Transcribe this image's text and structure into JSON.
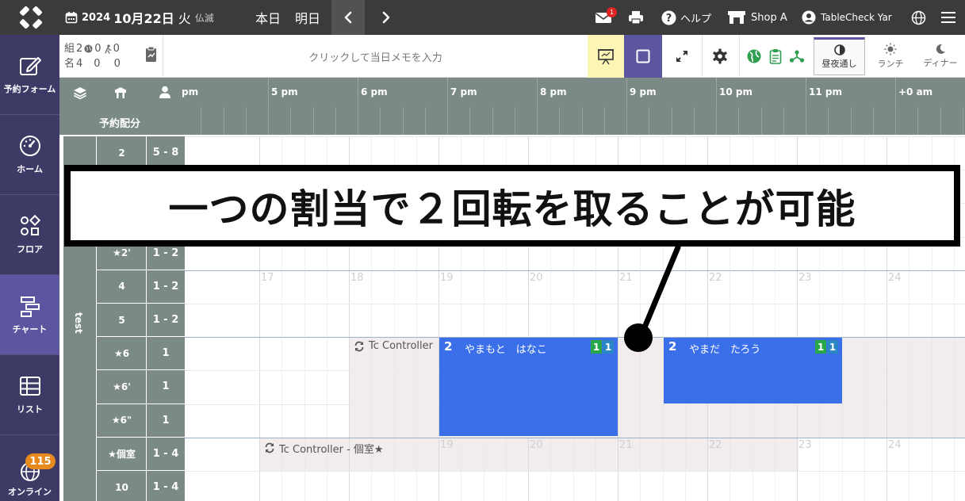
{
  "topbar": {
    "date_year": "2024",
    "date_monthday": "10月22日",
    "date_weekday": "火",
    "date_rokuyo": "仏滅",
    "today_label": "本日",
    "tomorrow_label": "明日",
    "mail_badge": "1",
    "help_label": "ヘルプ",
    "shop_label": "Shop A",
    "user_label": "TableCheck Yar"
  },
  "sidebar": {
    "items": [
      {
        "label": "予約フォーム",
        "icon": "edit-icon"
      },
      {
        "label": "ホーム",
        "icon": "dashboard-icon"
      },
      {
        "label": "フロア",
        "icon": "floor-icon"
      },
      {
        "label": "チャート",
        "icon": "chart-icon"
      },
      {
        "label": "リスト",
        "icon": "list-icon"
      },
      {
        "label": "オンライン",
        "icon": "globe-icon",
        "badge": "115"
      }
    ]
  },
  "toolbar": {
    "groups_label": "組",
    "groups_value": "2",
    "names_label": "名",
    "names_value": "4",
    "walkin_groups": "0",
    "web_groups": "0",
    "walkin_names": "0",
    "web_names": "0",
    "memo_placeholder": "クリックして当日メモを入力",
    "shift_all": "昼夜通し",
    "shift_lunch": "ランチ",
    "shift_dinner": "ディナー"
  },
  "grid": {
    "allocation_label": "予約配分",
    "section_label": "test",
    "hours": [
      "pm",
      "5 pm",
      "6 pm",
      "7 pm",
      "8 pm",
      "9 pm",
      "10 pm",
      "11 pm",
      "+0 am"
    ],
    "tables": [
      {
        "name": "2",
        "cap": "5 - 8"
      },
      {
        "name": "★2'",
        "cap": "1 - 2"
      },
      {
        "name": "4",
        "cap": "1 - 2"
      },
      {
        "name": "5",
        "cap": "1 - 2"
      },
      {
        "name": "★6",
        "cap": "1"
      },
      {
        "name": "★6'",
        "cap": "1"
      },
      {
        "name": "★6\"",
        "cap": "1"
      },
      {
        "name": "★個室",
        "cap": "1 - 4"
      },
      {
        "name": "10",
        "cap": "1 - 4"
      }
    ],
    "faint_hours_a": [
      "17",
      "18",
      "19",
      "20",
      "21",
      "22",
      "23",
      "24"
    ],
    "faint_hours_b": [
      "19",
      "20",
      "21",
      "22",
      "23",
      "24"
    ],
    "controller_label": "Tc Controller",
    "controller_label_private": "Tc Controller - 個室★",
    "reservations": [
      {
        "count": "2",
        "name": "やまもと　はなこ",
        "badge_green": "1",
        "badge_teal": "1"
      },
      {
        "count": "2",
        "name": "やまだ　たろう",
        "badge_green": "1",
        "badge_teal": "1"
      }
    ]
  },
  "annotation": {
    "text": "一つの割当で２回転を取ることが可能"
  },
  "colors": {
    "topbar": "#3b3b3b",
    "sidebar": "#3e3a66",
    "sidebar_active": "#5c56a0",
    "grid_header": "#7b8a86",
    "reservation": "#3b6fea",
    "shaded": "#f2ecec"
  }
}
